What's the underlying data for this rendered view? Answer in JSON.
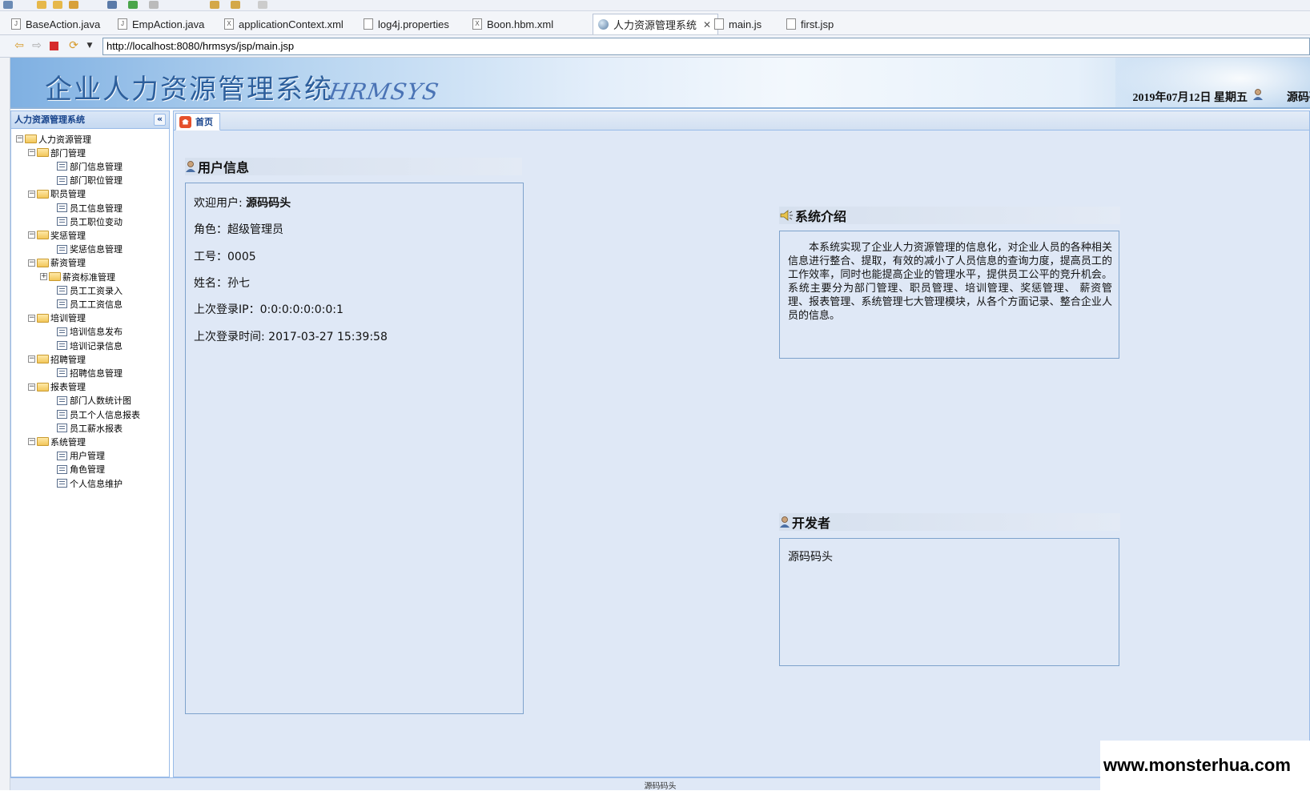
{
  "editor_tabs": [
    {
      "label": "BaseAction.java",
      "icon": "java-file-icon"
    },
    {
      "label": "EmpAction.java",
      "icon": "java-file-icon"
    },
    {
      "label": "applicationContext.xml",
      "icon": "xml-file-icon"
    },
    {
      "label": "log4j.properties",
      "icon": "properties-file-icon"
    },
    {
      "label": "Boon.hbm.xml",
      "icon": "xml-file-icon"
    },
    {
      "label": "人力资源管理系统",
      "icon": "globe-icon",
      "active": true
    },
    {
      "label": "main.js",
      "icon": "js-file-icon"
    },
    {
      "label": "first.jsp",
      "icon": "jsp-file-icon"
    }
  ],
  "browser": {
    "url": "http://localhost:8080/hrmsys/jsp/main.jsp"
  },
  "header": {
    "title": "企业人力资源管理系统",
    "logo_text": "HRMSYS",
    "date": "2019年07月12日 星期五",
    "user": "源码码"
  },
  "left_panel": {
    "title": "人力资源管理系统",
    "tree": [
      {
        "label": "人力资源管理",
        "level": 0,
        "type": "folder",
        "toggle": "−"
      },
      {
        "label": "部门管理",
        "level": 1,
        "type": "folder",
        "toggle": "−"
      },
      {
        "label": "部门信息管理",
        "level": 2,
        "type": "leaf"
      },
      {
        "label": "部门职位管理",
        "level": 2,
        "type": "leaf"
      },
      {
        "label": "职员管理",
        "level": 1,
        "type": "folder",
        "toggle": "−"
      },
      {
        "label": "员工信息管理",
        "level": 2,
        "type": "leaf"
      },
      {
        "label": "员工职位变动",
        "level": 2,
        "type": "leaf"
      },
      {
        "label": "奖惩管理",
        "level": 1,
        "type": "folder",
        "toggle": "−"
      },
      {
        "label": "奖惩信息管理",
        "level": 2,
        "type": "leaf"
      },
      {
        "label": "薪资管理",
        "level": 1,
        "type": "folder",
        "toggle": "−"
      },
      {
        "label": "薪资标准管理",
        "level": 2,
        "type": "folder",
        "toggle": "+"
      },
      {
        "label": "员工工资录入",
        "level": 2,
        "type": "leaf"
      },
      {
        "label": "员工工资信息",
        "level": 2,
        "type": "leaf"
      },
      {
        "label": "培训管理",
        "level": 1,
        "type": "folder",
        "toggle": "−"
      },
      {
        "label": "培训信息发布",
        "level": 2,
        "type": "leaf"
      },
      {
        "label": "培训记录信息",
        "level": 2,
        "type": "leaf"
      },
      {
        "label": "招聘管理",
        "level": 1,
        "type": "folder",
        "toggle": "−"
      },
      {
        "label": "招聘信息管理",
        "level": 2,
        "type": "leaf"
      },
      {
        "label": "报表管理",
        "level": 1,
        "type": "folder",
        "toggle": "−"
      },
      {
        "label": "部门人数统计图",
        "level": 2,
        "type": "leaf"
      },
      {
        "label": "员工个人信息报表",
        "level": 2,
        "type": "leaf"
      },
      {
        "label": "员工薪水报表",
        "level": 2,
        "type": "leaf"
      },
      {
        "label": "系统管理",
        "level": 1,
        "type": "folder",
        "toggle": "−"
      },
      {
        "label": "用户管理",
        "level": 2,
        "type": "leaf"
      },
      {
        "label": "角色管理",
        "level": 2,
        "type": "leaf"
      },
      {
        "label": "个人信息维护",
        "level": 2,
        "type": "leaf"
      }
    ]
  },
  "center": {
    "home_tab": "首页",
    "user_info": {
      "title": "用户信息",
      "welcome_label": "欢迎用户: ",
      "welcome_user": "源码码头",
      "role": "角色：超级管理员",
      "job_no": "工号：0005",
      "name": "姓名：孙七",
      "last_ip": "上次登录IP：0:0:0:0:0:0:0:1",
      "last_login": "上次登录时间: 2017-03-27 15:39:58"
    },
    "system_intro": {
      "title": "系统介绍",
      "text": "本系统实现了企业人力资源管理的信息化，对企业人员的各种相关信息进行整合、提取，有效的减小了人员信息的查询力度，提高员工的工作效率，同时也能提高企业的管理水平，提供员工公平的竞升机会。系统主要分为部门管理、职员管理、培训管理、奖惩管理、 薪资管理、报表管理、系统管理七大管理模块，从各个方面记录、整合企业人员的信息。"
    },
    "developer": {
      "title": "开发者",
      "name": "源码码头"
    }
  },
  "footer": {
    "text": "源码码头"
  },
  "watermark": "www.monsterhua.com"
}
